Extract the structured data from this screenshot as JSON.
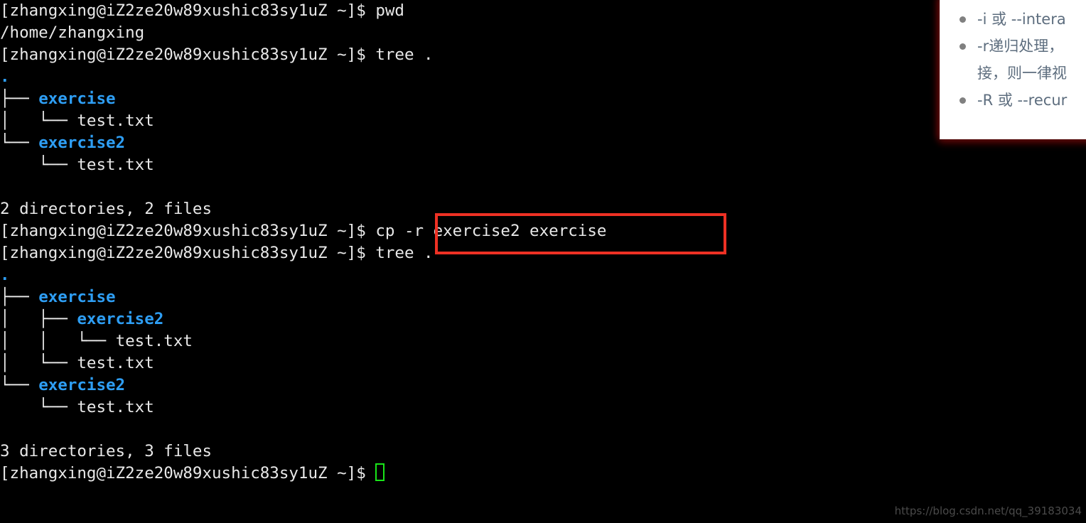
{
  "terminal": {
    "prompt": "[zhangxing@iZ2ze20w89xushic83sy1uZ ~]$ ",
    "lines": [
      {
        "type": "prompt",
        "prompt": "[zhangxing@iZ2ze20w89xushic83sy1uZ ~]$ ",
        "command": "pwd"
      },
      {
        "type": "output",
        "text": "/home/zhangxing"
      },
      {
        "type": "prompt",
        "prompt": "[zhangxing@iZ2ze20w89xushic83sy1uZ ~]$ ",
        "command": "tree ."
      },
      {
        "type": "root",
        "text": "."
      },
      {
        "type": "tree",
        "branch": "├── ",
        "name": "exercise",
        "kind": "dir"
      },
      {
        "type": "tree",
        "branch": "│   └── ",
        "name": "test.txt",
        "kind": "file"
      },
      {
        "type": "tree",
        "branch": "└── ",
        "name": "exercise2",
        "kind": "dir"
      },
      {
        "type": "tree",
        "branch": "    └── ",
        "name": "test.txt",
        "kind": "file"
      },
      {
        "type": "blank"
      },
      {
        "type": "output",
        "text": "2 directories, 2 files"
      },
      {
        "type": "prompt",
        "prompt": "[zhangxing@iZ2ze20w89xushic83sy1uZ ~]$ ",
        "command": "cp -r exercise2 exercise",
        "highlighted": true
      },
      {
        "type": "prompt",
        "prompt": "[zhangxing@iZ2ze20w89xushic83sy1uZ ~]$ ",
        "command": "tree ."
      },
      {
        "type": "root",
        "text": "."
      },
      {
        "type": "tree",
        "branch": "├── ",
        "name": "exercise",
        "kind": "dir"
      },
      {
        "type": "tree",
        "branch": "│   ├── ",
        "name": "exercise2",
        "kind": "dir"
      },
      {
        "type": "tree",
        "branch": "│   │   └── ",
        "name": "test.txt",
        "kind": "file"
      },
      {
        "type": "tree",
        "branch": "│   └── ",
        "name": "test.txt",
        "kind": "file"
      },
      {
        "type": "tree",
        "branch": "└── ",
        "name": "exercise2",
        "kind": "dir"
      },
      {
        "type": "tree",
        "branch": "    └── ",
        "name": "test.txt",
        "kind": "file"
      },
      {
        "type": "blank"
      },
      {
        "type": "output",
        "text": "3 directories, 3 files"
      },
      {
        "type": "cursor",
        "prompt": "[zhangxing@iZ2ze20w89xushic83sy1uZ ~]$ "
      }
    ],
    "highlight_color": "#ee3124",
    "dir_color": "#2e9ef4",
    "text_color": "#e6e6e6",
    "cursor_color": "#19e519",
    "background": "#000000"
  },
  "note_panel": {
    "items": [
      {
        "line1": "-i 或 --intera",
        "line2": ""
      },
      {
        "line1": "-r递归处理，",
        "line2": "接，则一律视"
      },
      {
        "line1": "-R 或 --recur",
        "line2": ""
      }
    ],
    "text_color": "#5d6d7e",
    "background": "#ffffff"
  },
  "watermark": {
    "text": "https://blog.csdn.net/qq_39183034"
  }
}
